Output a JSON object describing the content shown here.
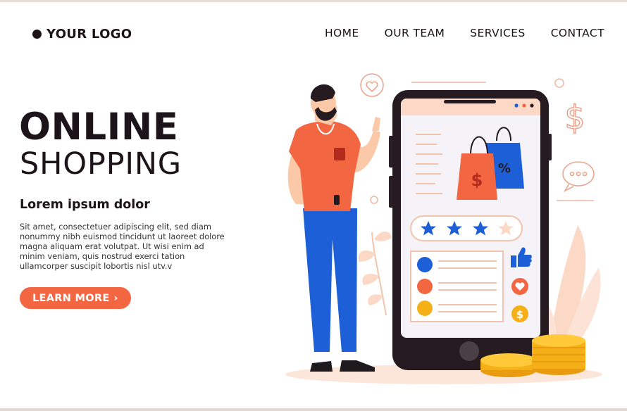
{
  "header": {
    "logo_text": "YOUR LOGO",
    "nav": [
      "HOME",
      "OUR TEAM",
      "SERVICES",
      "CONTACT"
    ]
  },
  "hero": {
    "title_line1": "ONLINE",
    "title_line2": "SHOPPING",
    "subtitle": "Lorem ipsum dolor",
    "body": "Sit amet, consectetuer adipiscing elit, sed diam nonummy nibh euismod tincidunt ut laoreet dolore magna aliquam erat volutpat. Ut wisi enim ad minim veniam, quis nostrud exerci tation ullamcorper suscipit lobortis nisl utv.v",
    "cta_label": "LEARN MORE",
    "cta_arrow": "›"
  },
  "illustration": {
    "discount_symbol": "%",
    "currency_symbol": "$",
    "rating": {
      "filled": 3,
      "total": 4
    }
  },
  "colors": {
    "accent": "#f26642",
    "dark": "#1c1418",
    "blue": "#1c5fd6",
    "gold": "#f5b018",
    "peach": "#fbd9c6"
  }
}
